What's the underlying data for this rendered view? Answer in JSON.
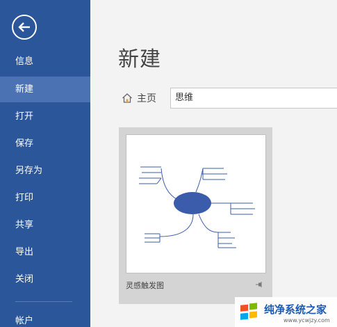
{
  "sidebar": {
    "items": [
      {
        "label": "信息"
      },
      {
        "label": "新建"
      },
      {
        "label": "打开"
      },
      {
        "label": "保存"
      },
      {
        "label": "另存为"
      },
      {
        "label": "打印"
      },
      {
        "label": "共享"
      },
      {
        "label": "导出"
      },
      {
        "label": "关闭"
      },
      {
        "label": "帐户"
      }
    ],
    "active": "新建",
    "back_icon": "arrow-left-icon"
  },
  "main": {
    "title": "新建",
    "home_label": "主页",
    "search_value": "思维",
    "templates": [
      {
        "name": "灵感触发图",
        "thumbnail": "mind-map"
      }
    ]
  },
  "watermark": {
    "title": "纯净系统之家",
    "url": "www.ycwjzy.com"
  },
  "colors": {
    "sidebar_bg": "#2b579a",
    "sidebar_active": "#4b73b4",
    "main_bg": "#f3f3f3",
    "mindmap_blue": "#3b5cab"
  }
}
